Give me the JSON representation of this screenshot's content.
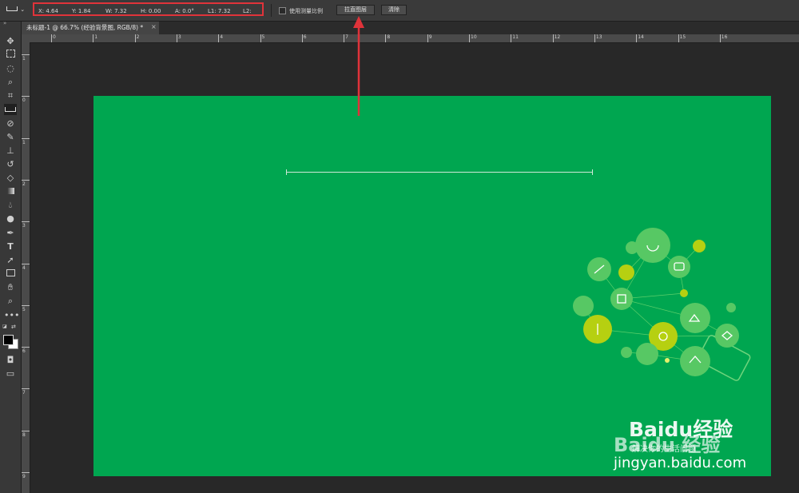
{
  "options_bar": {
    "tool_preset_icon": "ruler-icon",
    "x": "X: 4.64",
    "y": "Y: 1.84",
    "w": "W: 7.32",
    "h": "H: 0.00",
    "a": "A: 0.0°",
    "l1": "L1: 7.32",
    "l2": "L2:",
    "use_scale_label": "使用测量比例",
    "straighten_button": "拉直图层",
    "clear_button": "清除"
  },
  "document": {
    "tab_title": "未标题-1 @ 66.7% (经验背景图, RGB/8) *",
    "close_glyph": "×"
  },
  "rulers": {
    "horizontal": [
      "0",
      "1",
      "2",
      "3",
      "4",
      "5",
      "6",
      "7",
      "8",
      "9",
      "10",
      "11",
      "12",
      "13",
      "14",
      "15",
      "16"
    ],
    "vertical": [
      "1",
      "0",
      "1",
      "2",
      "3",
      "4",
      "5",
      "6",
      "7",
      "8",
      "9"
    ]
  },
  "tools": [
    "move-icon",
    "marquee-icon",
    "lasso-icon",
    "quick-select-icon",
    "crop-icon",
    "ruler-icon",
    "healing-brush-icon",
    "brush-icon",
    "clone-stamp-icon",
    "history-brush-icon",
    "eraser-icon",
    "gradient-icon",
    "blur-icon",
    "dodge-icon",
    "pen-icon",
    "type-icon",
    "path-select-icon",
    "rectangle-icon",
    "hand-icon",
    "zoom-icon",
    "more-tools-icon"
  ],
  "colors": {
    "canvas": "#00a650",
    "highlight": "#e0333a",
    "bulb_light": "#4cc45c",
    "bulb_yellow": "#b8cf14"
  },
  "watermark": {
    "brand": "Baidu经验",
    "slogan": "解决你的生活问题",
    "brand_overlay": "Baidu 经验",
    "url": "jingyan.baidu.com"
  }
}
